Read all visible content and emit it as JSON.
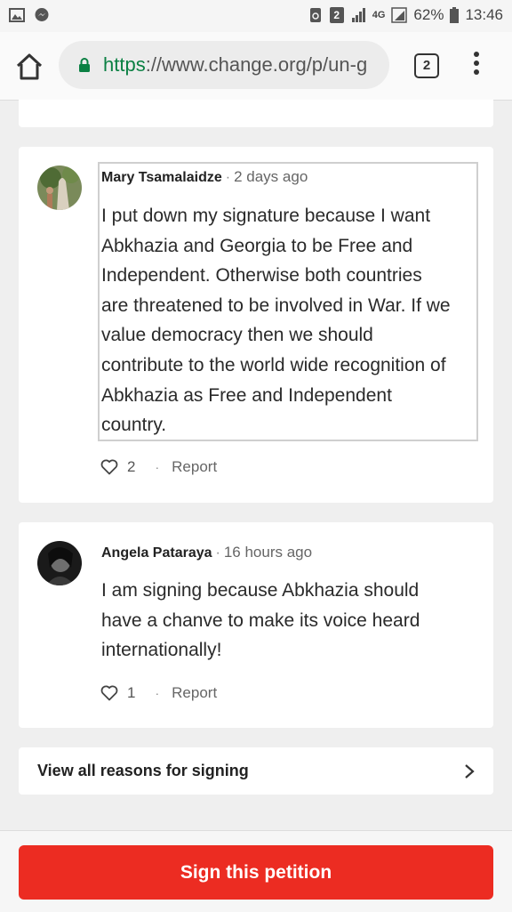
{
  "status_bar": {
    "battery": "62%",
    "time": "13:46",
    "sim_badge": "2",
    "network": "4G"
  },
  "browser": {
    "url_scheme": "https",
    "url_rest": "://www.change.org/p/un-g",
    "tab_count": "2"
  },
  "comments": [
    {
      "name": "Mary Tsamalaidze",
      "separator": "·",
      "time": "2 days ago",
      "lines": [
        "I put down my signature because I want",
        "Abkhazia and Georgia to be Free and",
        "Independent. Otherwise both countries",
        "are threatened to be involved in War. If we",
        "value democracy then we should",
        "contribute to the world wide recognition of",
        "Abkhazia as Free and Independent",
        "country."
      ],
      "likes": "2",
      "report": "Report"
    },
    {
      "name": "Angela Pataraya",
      "separator": "·",
      "time": "16 hours ago",
      "lines": [
        "I am signing because Abkhazia should",
        "have a chanve to make its voice heard",
        "internationally!"
      ],
      "likes": "1",
      "report": "Report"
    }
  ],
  "view_all": {
    "label": "View all reasons for signing"
  },
  "cta": {
    "label": "Sign this petition"
  },
  "colors": {
    "accent": "#ec2c22",
    "secure": "#0b8043"
  }
}
